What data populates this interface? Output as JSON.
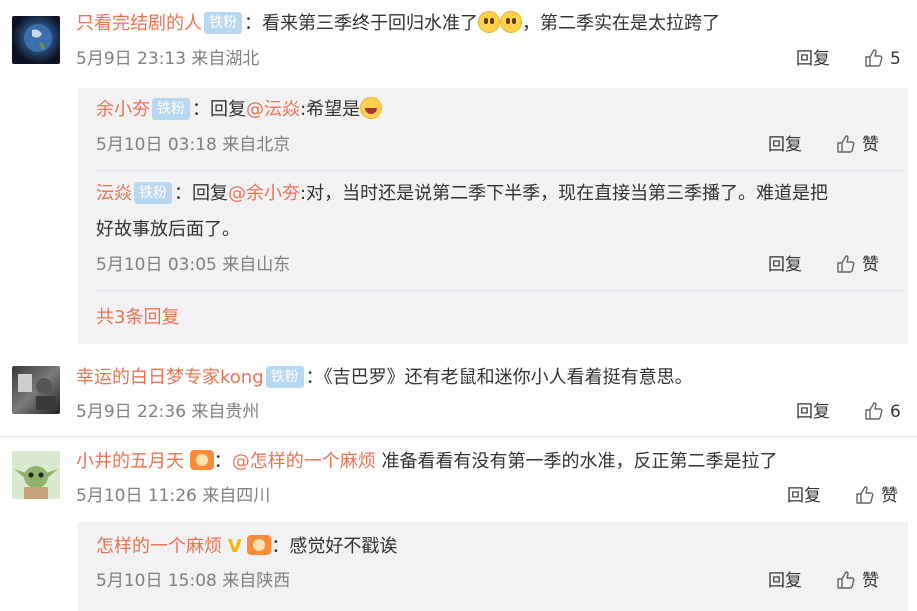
{
  "comments": [
    {
      "user": "只看完结剧的人",
      "badge": "铁粉",
      "text_a": "：看来第三季终于回归水准了",
      "text_b": "，第二季实在是太拉跨了",
      "time": "5月9日 23:13 来自湖北",
      "reply_label": "回复",
      "likes": "5",
      "replies": [
        {
          "user": "余小夯",
          "badge": "铁粉",
          "prefix": "：回复",
          "mention": "@沄焱",
          "text": ":希望是",
          "time": "5月10日 03:18 来自北京",
          "reply_label": "回复",
          "likes": "赞"
        },
        {
          "user": "沄焱",
          "badge": "铁粉",
          "prefix": "：回复",
          "mention": "@余小夯",
          "text": ":对，当时还是说第二季下半季，现在直接当第三季播了。难道是把",
          "text2": "好故事放后面了。",
          "time": "5月10日 03:05 来自山东",
          "reply_label": "回复",
          "likes": "赞"
        }
      ],
      "more_replies": "共3条回复"
    },
    {
      "user": "幸运的白日梦专家kong",
      "badge": "铁粉",
      "text_a": "：《吉巴罗》还有老鼠和迷你小人看着挺有意思。",
      "time": "5月9日 22:36 来自贵州",
      "reply_label": "回复",
      "likes": "6"
    },
    {
      "user": "小井的五月天",
      "colon": "：",
      "mention": "@怎样的一个麻烦",
      "text_a": " 准备看看有没有第一季的水准，反正第二季是拉了",
      "time": "5月10日 11:26 来自四川",
      "reply_label": "回复",
      "likes": "赞",
      "replies": [
        {
          "user": "怎样的一个麻烦",
          "v": "V",
          "text": "：感觉好不戳诶",
          "time": "5月10日 15:08 来自陕西",
          "reply_label": "回复",
          "likes": "赞"
        }
      ]
    }
  ]
}
